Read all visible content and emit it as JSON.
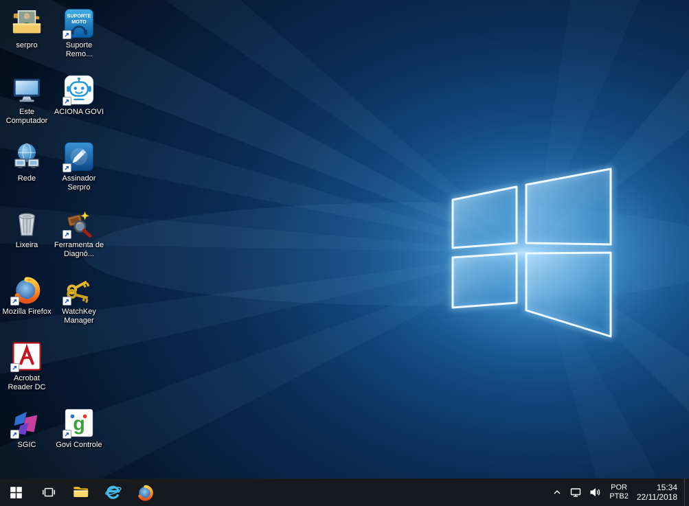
{
  "wallpaper": {
    "base_color": "#030c1a",
    "glow_color": "#2b86c8",
    "logo_stroke": "#eef9ff"
  },
  "desktop": {
    "icons": [
      {
        "name": "serpro",
        "label": "serpro",
        "icon": "user-folder-icon",
        "shortcut": false
      },
      {
        "name": "suporte-remoto",
        "label": "Suporte Remo...",
        "icon": "suporte-remoto-icon",
        "icon_text_line1": "SUPORTE",
        "icon_text_line2": "MOTO",
        "shortcut": true
      },
      {
        "name": "este-computador",
        "label": "Este Computador",
        "icon": "computer-icon",
        "shortcut": false
      },
      {
        "name": "aciona-govi",
        "label": "ACIONA GOVI",
        "icon": "robot-icon",
        "shortcut": true
      },
      {
        "name": "rede",
        "label": "Rede",
        "icon": "network-globe-icon",
        "shortcut": false
      },
      {
        "name": "assinador-serpro",
        "label": "Assinador Serpro",
        "icon": "signature-pen-icon",
        "shortcut": true
      },
      {
        "name": "lixeira",
        "label": "Lixeira",
        "icon": "recycle-bin-icon",
        "shortcut": false
      },
      {
        "name": "ferramenta-diagnostico",
        "label": "Ferramenta de Diagnó...",
        "icon": "diagnostic-tool-icon",
        "shortcut": true
      },
      {
        "name": "mozilla-firefox",
        "label": "Mozilla Firefox",
        "icon": "firefox-icon",
        "shortcut": true
      },
      {
        "name": "watchkey-manager",
        "label": "WatchKey Manager",
        "icon": "keys-icon",
        "shortcut": true
      },
      {
        "name": "acrobat-reader",
        "label": "Acrobat Reader DC",
        "icon": "acrobat-reader-icon",
        "shortcut": true
      },
      {
        "name": "sgic",
        "label": "SGIC",
        "icon": "sgic-icon",
        "shortcut": true
      },
      {
        "name": "govi-controle",
        "label": "Govi Controle",
        "icon": "govi-icon",
        "icon_letter": "g",
        "shortcut": true
      }
    ]
  },
  "taskbar": {
    "buttons": [
      {
        "name": "start",
        "icon": "windows-logo-icon"
      },
      {
        "name": "task-view",
        "icon": "task-view-icon"
      },
      {
        "name": "file-explorer",
        "icon": "folder-icon"
      },
      {
        "name": "internet-explorer",
        "icon": "ie-icon"
      },
      {
        "name": "firefox",
        "icon": "firefox-icon"
      }
    ],
    "tray": {
      "expand_icon": "chevron-up-icon",
      "network_icon": "network-status-icon",
      "volume_icon": "speaker-icon",
      "language_line1": "POR",
      "language_line2": "PTB2",
      "time": "15:34",
      "date": "22/11/2018"
    }
  }
}
